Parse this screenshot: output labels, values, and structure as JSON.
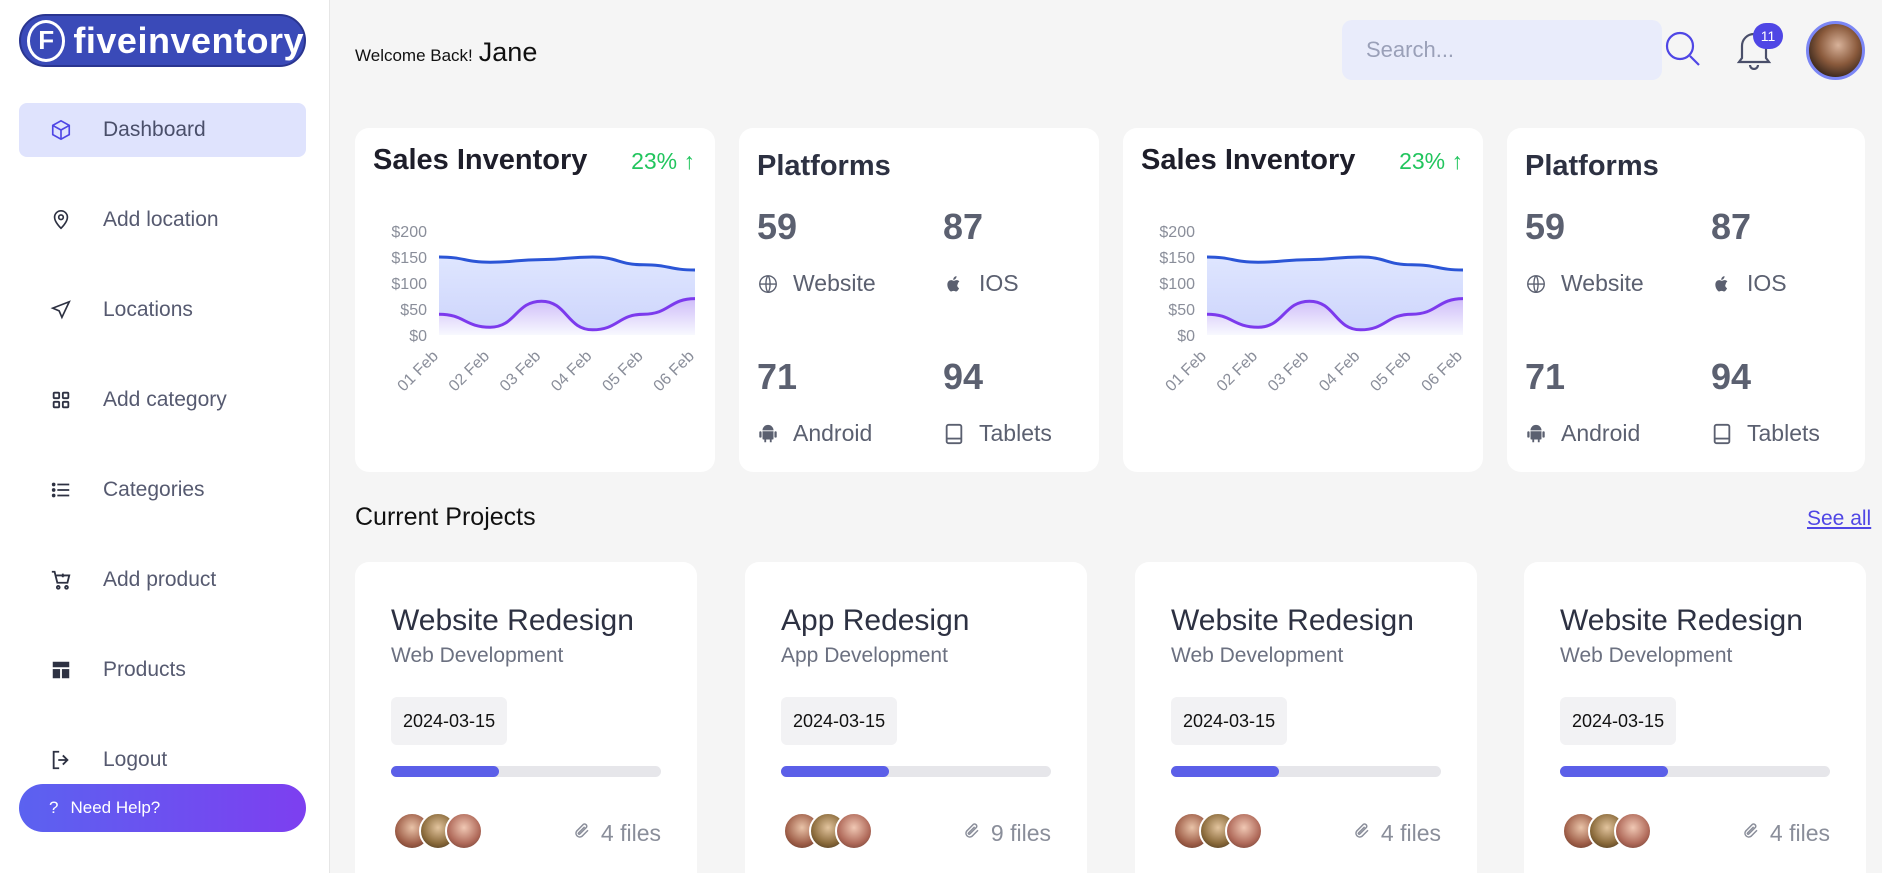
{
  "app": {
    "logo_letter": "F",
    "logo_text": "fiveinventory"
  },
  "sidebar": {
    "items": [
      {
        "label": "Dashboard",
        "icon": "cube-icon",
        "active": true
      },
      {
        "label": "Add location",
        "icon": "map-pin-icon"
      },
      {
        "label": "Locations",
        "icon": "send-icon"
      },
      {
        "label": "Add category",
        "icon": "grid-icon"
      },
      {
        "label": "Categories",
        "icon": "list-icon"
      },
      {
        "label": "Add product",
        "icon": "cart-plus-icon"
      },
      {
        "label": "Products",
        "icon": "layout-icon"
      },
      {
        "label": "Logout",
        "icon": "logout-icon"
      }
    ],
    "help_icon": "?",
    "help_label": "Need Help?"
  },
  "header": {
    "welcome_label": "Welcome Back!",
    "user_name": "Jane",
    "search_placeholder": "Search...",
    "notification_count": "11"
  },
  "colors": {
    "accent": "#4f46e5",
    "positive": "#22c55e",
    "line_blue": "#2b55d6",
    "line_purple": "#7c3aed"
  },
  "sales_cards": [
    {
      "title": "Sales Inventory",
      "change": "23% ↑"
    },
    {
      "title": "Sales Inventory",
      "change": "23% ↑"
    }
  ],
  "chart_data": {
    "type": "area",
    "x": [
      "01 Feb",
      "02 Feb",
      "03 Feb",
      "04 Feb",
      "05 Feb",
      "06 Feb"
    ],
    "y_ticks": [
      "$200",
      "$150",
      "$100",
      "$50",
      "$0"
    ],
    "ylim": [
      0,
      200
    ],
    "series": [
      {
        "values": [
          150,
          140,
          145,
          150,
          135,
          125
        ]
      },
      {
        "values": [
          40,
          15,
          65,
          10,
          40,
          70
        ]
      }
    ]
  },
  "platform_cards": [
    {
      "title": "Platforms",
      "items": [
        {
          "count": "59",
          "label": "Website",
          "icon": "globe-icon"
        },
        {
          "count": "87",
          "label": "IOS",
          "icon": "apple-icon"
        },
        {
          "count": "71",
          "label": "Android",
          "icon": "android-icon"
        },
        {
          "count": "94",
          "label": "Tablets",
          "icon": "tablet-icon"
        }
      ]
    },
    {
      "title": "Platforms",
      "items": [
        {
          "count": "59",
          "label": "Website",
          "icon": "globe-icon"
        },
        {
          "count": "87",
          "label": "IOS",
          "icon": "apple-icon"
        },
        {
          "count": "71",
          "label": "Android",
          "icon": "android-icon"
        },
        {
          "count": "94",
          "label": "Tablets",
          "icon": "tablet-icon"
        }
      ]
    }
  ],
  "projects": {
    "title": "Current Projects",
    "see_all": "See all",
    "items": [
      {
        "title": "Website Redesign",
        "subtitle": "Web Development",
        "date": "2024-03-15",
        "progress": 0.4,
        "files": "4 files"
      },
      {
        "title": "App Redesign",
        "subtitle": "App Development",
        "date": "2024-03-15",
        "progress": 0.4,
        "files": "9 files"
      },
      {
        "title": "Website Redesign",
        "subtitle": "Web Development",
        "date": "2024-03-15",
        "progress": 0.4,
        "files": "4 files"
      },
      {
        "title": "Website Redesign",
        "subtitle": "Web Development",
        "date": "2024-03-15",
        "progress": 0.4,
        "files": "4 files"
      }
    ]
  }
}
